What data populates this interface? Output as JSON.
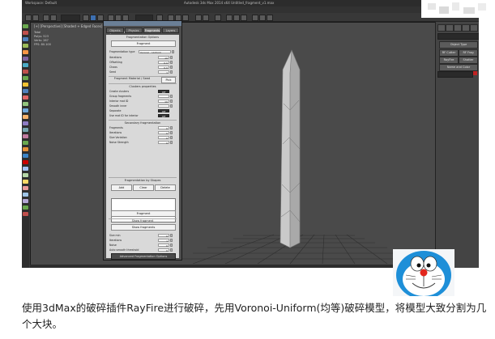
{
  "window": {
    "title_left": "Workspace: Default",
    "title_center": "Autodesk 3ds Max 2014 x64    Untitled_fragment_v1.max"
  },
  "menu": [
    "Edit",
    "Tools",
    "Group",
    "Views",
    "Create",
    "Modifiers",
    "Animation",
    "Graph Editors",
    "Rendering",
    "Customize",
    "MAXScript",
    "Help"
  ],
  "viewport": {
    "label": "[+] [Perspective] [Shaded + Edged Faces]",
    "stats": [
      "Total",
      "Polys: 523",
      "Verts: 267",
      "",
      "FPS: 80.100"
    ]
  },
  "right_panel": {
    "object_type_label": "Object Type",
    "buttons": [
      "RF Cutter",
      "RF Frag",
      "RayFire",
      "Shatter"
    ],
    "name_color_label": "Name and Color",
    "swatch_color": "#c02222"
  },
  "dialog": {
    "title": "RayFire Shatter v1.0",
    "tabs": [
      "Objects",
      "Physics",
      "Fragments",
      "Layers"
    ],
    "active_tab": 2,
    "section_fragmentation": "Fragmentation Options",
    "fragment_button_top": "Fragment",
    "type_label": "Fragmentation type",
    "type_value": "Voronoi - Uniform",
    "rows_top": [
      {
        "label": "Iterations",
        "value": "10"
      },
      {
        "label": "Offsetting",
        "value": "0.0"
      },
      {
        "label": "Chaos",
        "value": "0.0"
      },
      {
        "label": "Seed",
        "value": "1"
      }
    ],
    "section_material": "Fragment Material / Seed",
    "seed_button": "Pick",
    "section_clusters": "Clusters properties",
    "cluster_rows": [
      {
        "label": "Create clusters",
        "value": "Off"
      },
      {
        "label": "Group fragments",
        "value": ""
      },
      {
        "label": "Interior mat ID",
        "value": "10"
      },
      {
        "label": "Smooth inner",
        "value": ""
      },
      {
        "label": "Separate",
        "value": "Off"
      },
      {
        "label": "Use mat ID for interior",
        "value": "Off"
      }
    ],
    "section_secondary": "Secondary fragmentation",
    "secondary_rows": [
      {
        "label": "Fragments",
        "value": "0"
      },
      {
        "label": "Iterations",
        "value": "0"
      },
      {
        "label": "Size Variation",
        "value": "0"
      },
      {
        "label": "Noise Strength",
        "value": "0"
      }
    ],
    "section_by_shapes": "Fragmentation by Shapes",
    "shape_buttons": [
      "Add",
      "Clear",
      "Delete"
    ],
    "fragment_button_mid": "Fragment",
    "section_show": "Show fragment",
    "show_button": "Show fragments",
    "bottom_rows": [
      {
        "label": "Size min",
        "value": "0"
      },
      {
        "label": "Iterations",
        "value": "1"
      },
      {
        "label": "Noise",
        "value": "0"
      },
      {
        "label": "Auto smooth threshold",
        "value": "0"
      }
    ],
    "footer": "Advanced Fragmentation Options"
  },
  "caption": "使用3dMax的破碎插件RayFire进行破碎，先用Voronoi-Uniform(均等)破碎模型，将模型大致分割为几个大块。",
  "colors": {
    "viewport_bg": "#4a4a4a",
    "dialog_panel": "#d9d9d9",
    "accent_red": "#c02222"
  }
}
